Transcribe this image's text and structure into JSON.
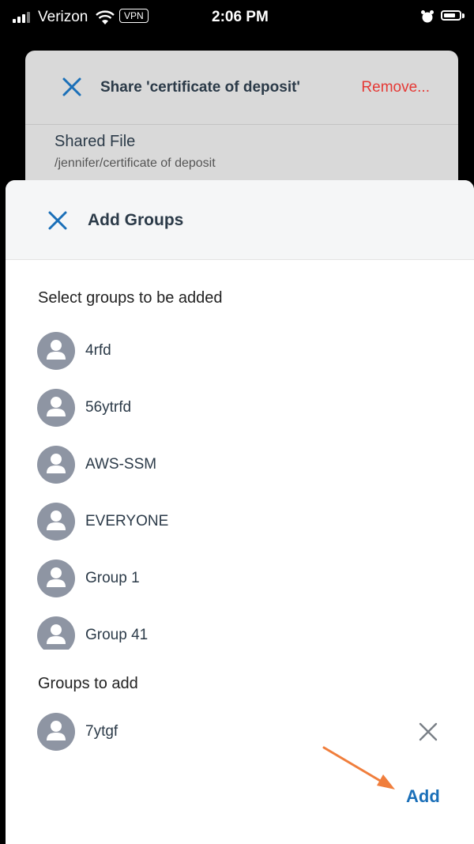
{
  "status_bar": {
    "carrier": "Verizon",
    "vpn": "VPN",
    "time": "2:06 PM"
  },
  "share_dialog": {
    "title": "Share 'certificate of deposit'",
    "remove_label": "Remove...",
    "shared_file_label": "Shared File",
    "shared_file_path": "/jennifer/certificate of deposit"
  },
  "add_groups": {
    "title": "Add Groups",
    "select_label": "Select groups to be added",
    "groups": [
      {
        "name": "4rfd"
      },
      {
        "name": "56ytrfd"
      },
      {
        "name": "AWS-SSM"
      },
      {
        "name": "EVERYONE"
      },
      {
        "name": "Group 1"
      },
      {
        "name": "Group 41"
      }
    ],
    "to_add_label": "Groups to add",
    "to_add": [
      {
        "name": "7ytgf"
      }
    ],
    "add_button": "Add"
  },
  "colors": {
    "accent": "#1a6fb8",
    "danger": "#e53935",
    "avatar": "#8e95a3",
    "annotation_arrow": "#f07e3c"
  },
  "icons": {
    "close": "close-icon",
    "avatar": "user-avatar-icon"
  }
}
